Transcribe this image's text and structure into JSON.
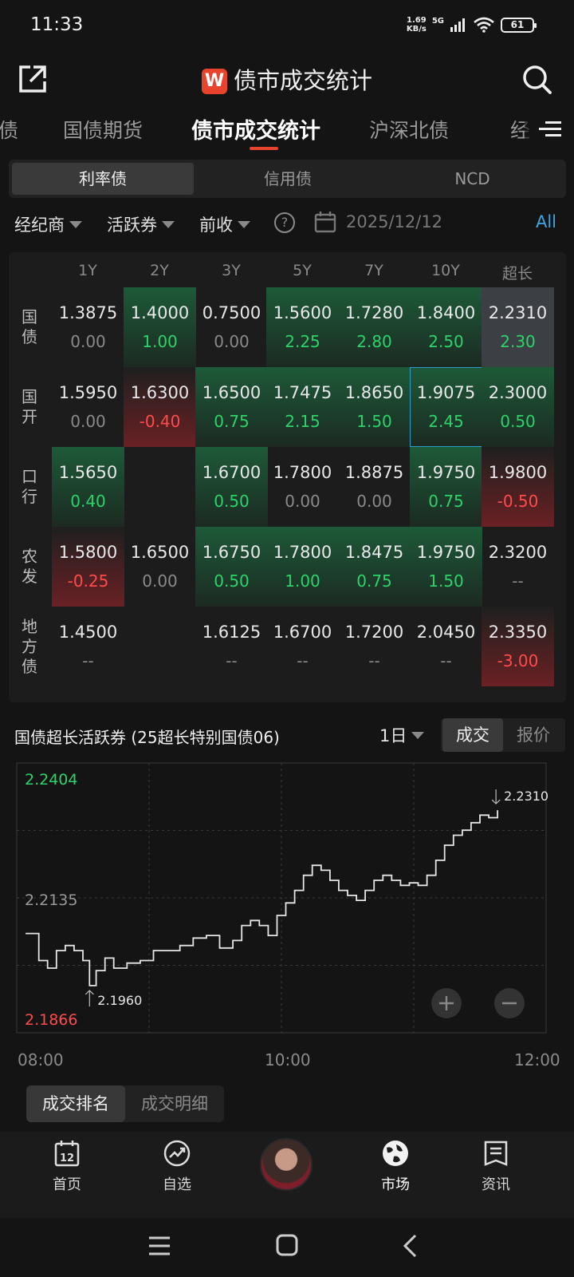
{
  "status": {
    "time": "11:33",
    "speed": "1.69",
    "speed_unit": "KB/s",
    "network": "5G",
    "battery": "61"
  },
  "header": {
    "title": "债市成交统计",
    "logo_text": "W"
  },
  "tabs": [
    {
      "label": "债"
    },
    {
      "label": "国债期货"
    },
    {
      "label": "债市成交统计",
      "active": true
    },
    {
      "label": "沪深北债"
    },
    {
      "label": "经"
    }
  ],
  "segments": [
    {
      "label": "利率债",
      "active": true
    },
    {
      "label": "信用债"
    },
    {
      "label": "NCD"
    }
  ],
  "filters": {
    "broker": "经纪商",
    "bond": "活跃券",
    "price": "前收",
    "date": "2025/12/12",
    "all": "All"
  },
  "grid": {
    "columns": [
      "1Y",
      "2Y",
      "3Y",
      "5Y",
      "7Y",
      "10Y",
      "超长"
    ],
    "rows": [
      {
        "name": "国债",
        "cells": [
          {
            "v": "1.3875",
            "c": "0.00",
            "s": "n",
            "bg": ""
          },
          {
            "v": "1.4000",
            "c": "1.00",
            "s": "g",
            "bg": "green"
          },
          {
            "v": "0.7500",
            "c": "0.00",
            "s": "n",
            "bg": ""
          },
          {
            "v": "1.5600",
            "c": "2.25",
            "s": "g",
            "bg": "green"
          },
          {
            "v": "1.7280",
            "c": "2.80",
            "s": "g",
            "bg": "green"
          },
          {
            "v": "1.8400",
            "c": "2.50",
            "s": "g",
            "bg": "green"
          },
          {
            "v": "2.2310",
            "c": "2.30",
            "s": "g",
            "bg": "gray"
          }
        ]
      },
      {
        "name": "国开",
        "cells": [
          {
            "v": "1.5950",
            "c": "0.00",
            "s": "n",
            "bg": ""
          },
          {
            "v": "1.6300",
            "c": "-0.40",
            "s": "r",
            "bg": "red"
          },
          {
            "v": "1.6500",
            "c": "0.75",
            "s": "g",
            "bg": "green"
          },
          {
            "v": "1.7475",
            "c": "2.15",
            "s": "g",
            "bg": "green"
          },
          {
            "v": "1.8650",
            "c": "1.50",
            "s": "g",
            "bg": "green"
          },
          {
            "v": "1.9075",
            "c": "2.45",
            "s": "g",
            "bg": "green",
            "hl": true
          },
          {
            "v": "2.3000",
            "c": "0.50",
            "s": "g",
            "bg": "green"
          }
        ]
      },
      {
        "name": "口行",
        "cells": [
          {
            "v": "1.5650",
            "c": "0.40",
            "s": "g",
            "bg": "green"
          },
          {
            "v": "",
            "c": "",
            "s": "n",
            "bg": ""
          },
          {
            "v": "1.6700",
            "c": "0.50",
            "s": "g",
            "bg": "green"
          },
          {
            "v": "1.7800",
            "c": "0.00",
            "s": "n",
            "bg": ""
          },
          {
            "v": "1.8875",
            "c": "0.00",
            "s": "n",
            "bg": ""
          },
          {
            "v": "1.9750",
            "c": "0.75",
            "s": "g",
            "bg": "green"
          },
          {
            "v": "1.9800",
            "c": "-0.50",
            "s": "r",
            "bg": "red"
          }
        ]
      },
      {
        "name": "农发",
        "cells": [
          {
            "v": "1.5800",
            "c": "-0.25",
            "s": "r",
            "bg": "red"
          },
          {
            "v": "1.6500",
            "c": "0.00",
            "s": "n",
            "bg": ""
          },
          {
            "v": "1.6750",
            "c": "0.50",
            "s": "g",
            "bg": "green"
          },
          {
            "v": "1.7800",
            "c": "1.00",
            "s": "g",
            "bg": "green"
          },
          {
            "v": "1.8475",
            "c": "0.75",
            "s": "g",
            "bg": "green"
          },
          {
            "v": "1.9750",
            "c": "1.50",
            "s": "g",
            "bg": "green"
          },
          {
            "v": "2.3200",
            "c": "--",
            "s": "n",
            "bg": ""
          }
        ]
      },
      {
        "name": "地方债",
        "cells": [
          {
            "v": "1.4500",
            "c": "--",
            "s": "n",
            "bg": ""
          },
          {
            "v": "",
            "c": "",
            "s": "n",
            "bg": ""
          },
          {
            "v": "1.6125",
            "c": "--",
            "s": "n",
            "bg": ""
          },
          {
            "v": "1.6700",
            "c": "--",
            "s": "n",
            "bg": ""
          },
          {
            "v": "1.7200",
            "c": "--",
            "s": "n",
            "bg": ""
          },
          {
            "v": "2.0450",
            "c": "--",
            "s": "n",
            "bg": ""
          },
          {
            "v": "2.3350",
            "c": "-3.00",
            "s": "r",
            "bg": "red"
          }
        ]
      }
    ]
  },
  "chart_header": {
    "title": "国债超长活跃券 (25超长特别国债06)",
    "period": "1日",
    "toggle": [
      "成交",
      "报价"
    ]
  },
  "chart_data": {
    "type": "line",
    "y_top_label": "2.2404",
    "y_mid_label": "2.2135",
    "y_bottom_label": "2.1866",
    "ylim": [
      2.1866,
      2.2404
    ],
    "x_ticks": [
      "08:00",
      "10:00",
      "12:00"
    ],
    "xlim_minutes": [
      480,
      720
    ],
    "high_label": "2.2310",
    "low_label": "2.1960",
    "series": [
      {
        "points": [
          [
            484,
            2.2064
          ],
          [
            490,
            2.201
          ],
          [
            494,
            2.1995
          ],
          [
            498,
            2.203
          ],
          [
            502,
            2.204
          ],
          [
            506,
            2.203
          ],
          [
            510,
            2.201
          ],
          [
            513,
            2.196
          ],
          [
            516,
            2.199
          ],
          [
            520,
            2.2015
          ],
          [
            524,
            2.1995
          ],
          [
            530,
            2.2005
          ],
          [
            536,
            2.201
          ],
          [
            542,
            2.203
          ],
          [
            548,
            2.203
          ],
          [
            554,
            2.204
          ],
          [
            560,
            2.2055
          ],
          [
            566,
            2.206
          ],
          [
            572,
            2.2035
          ],
          [
            578,
            2.205
          ],
          [
            582,
            2.208
          ],
          [
            586,
            2.209
          ],
          [
            590,
            2.208
          ],
          [
            594,
            2.206
          ],
          [
            598,
            2.21
          ],
          [
            602,
            2.2125
          ],
          [
            606,
            2.215
          ],
          [
            610,
            2.218
          ],
          [
            614,
            2.22
          ],
          [
            618,
            2.219
          ],
          [
            622,
            2.217
          ],
          [
            626,
            2.215
          ],
          [
            630,
            2.214
          ],
          [
            634,
            2.213
          ],
          [
            638,
            2.215
          ],
          [
            642,
            2.217
          ],
          [
            646,
            2.218
          ],
          [
            650,
            2.217
          ],
          [
            654,
            2.216
          ],
          [
            658,
            2.2165
          ],
          [
            662,
            2.216
          ],
          [
            666,
            2.218
          ],
          [
            670,
            2.221
          ],
          [
            674,
            2.224
          ],
          [
            678,
            2.226
          ],
          [
            682,
            2.227
          ],
          [
            686,
            2.2285
          ],
          [
            690,
            2.23
          ],
          [
            694,
            2.2295
          ],
          [
            698,
            2.231
          ]
        ]
      }
    ]
  },
  "subtabs": [
    {
      "label": "成交排名",
      "active": true
    },
    {
      "label": "成交明细"
    }
  ],
  "bottom_nav": [
    {
      "label": "首页",
      "icon": "calendar-icon"
    },
    {
      "label": "自选",
      "icon": "trend-icon"
    },
    {
      "label": "市场",
      "icon": "globe-icon",
      "active": true
    },
    {
      "label": "资讯",
      "icon": "news-icon"
    }
  ],
  "colors": {
    "up": "#2bd46a",
    "down": "#ff4b4b",
    "accent": "#e8432d",
    "link": "#3ba6e0"
  }
}
